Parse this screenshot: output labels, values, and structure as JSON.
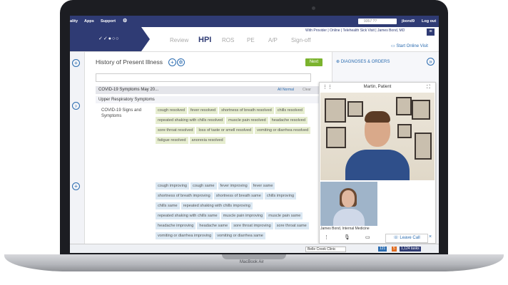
{
  "topnav": {
    "items": [
      "ality",
      "Apps",
      "Support"
    ],
    "search_placeholder": "9357 ??",
    "user": "jbond9",
    "logout": "Log out"
  },
  "workflow": {
    "steps": [
      "Review",
      "HPI",
      "ROS",
      "PE",
      "A/P",
      "Sign-off"
    ],
    "active": "HPI",
    "provider_line": "With Provider | Online | Telehealth Sick Visit | James Bond, MD",
    "start_online_visit": "Start Online Visit"
  },
  "hpi": {
    "title": "History of Present Illness",
    "next_label": "Next",
    "section_title": "COVID-19 Symptoms May 20...",
    "all_normal": "All Normal",
    "clear": "Clear",
    "subsection": "Upper Respiratory Symptoms",
    "side_label": "COVID-19 Signs and Symptoms",
    "resolved_chips": [
      "cough resolved",
      "fever resolved",
      "shortness of breath resolved",
      "chills resolved",
      "repeated shaking with chills resolved",
      "muscle pain resolved",
      "headache resolved",
      "sore throat resolved",
      "loss of taste or smell resolved",
      "vomiting or diarrhea resolved",
      "fatigue resolved",
      "anorexia resolved"
    ],
    "status_chips": [
      "cough improving",
      "cough same",
      "fever improving",
      "fever same",
      "shortness of breath improving",
      "shortness of breath same",
      "chills improving",
      "chills same",
      "repeated shaking with chills improving",
      "repeated shaking with chills same",
      "muscle pain improving",
      "muscle pain same",
      "headache improving",
      "headache same",
      "sore throat improving",
      "sore throat same",
      "vomiting or diarrhea improving",
      "vomiting or diarrhea same"
    ]
  },
  "right_panel": {
    "diagnoses": "DIAGNOSES & ORDERS"
  },
  "video": {
    "title": "Martin, Patient",
    "small_name": "James Bond, Internal Medicine",
    "leave_call": "Leave Call"
  },
  "statusbar": {
    "location": "Belle Creek Clinic",
    "count_a": "121",
    "count_b": "5",
    "tasks": "1,124 tasks"
  },
  "laptop": {
    "model": "MacBook Air"
  },
  "colors": {
    "brand": "#2f3b74",
    "accent": "#2b6cb0",
    "next": "#7bb32e",
    "chip_resolved": "#e6edcf",
    "chip_status": "#dbe8f3"
  }
}
